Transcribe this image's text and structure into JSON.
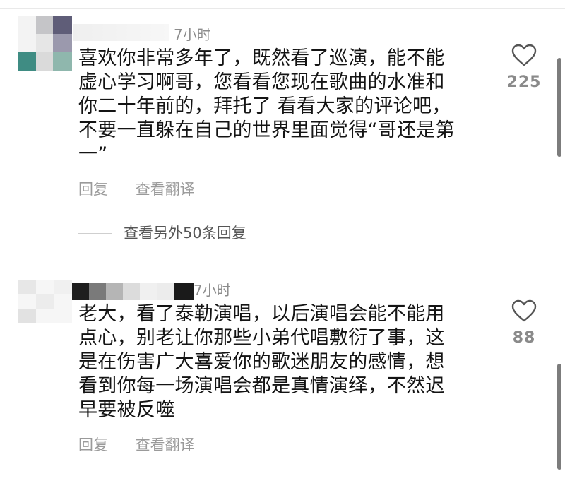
{
  "comments": [
    {
      "time": "7小时",
      "lines": [
        "喜欢你非常多年了，既然看了巡演，能不能",
        "虚心学习啊哥，您看看您现在歌曲的水准和",
        "你二十年前的，拜托了 看看大家的评论吧，",
        "不要一直躲在自己的世界里面觉得“哥还是第",
        "一”"
      ],
      "reply": "回复",
      "translate": "查看翻译",
      "likes": "225",
      "more_replies": "查看另外50条回复"
    },
    {
      "time": "7小时",
      "lines": [
        "老大，看了泰勒演唱，以后演唱会能不能用",
        "点心，别老让你那些小弟代唱敷衍了事，这",
        "是在伤害广大喜爱你的歌迷朋友的感情，想",
        "看到你每一场演唱会都是真情演绎，不然迟",
        "早要被反噬"
      ],
      "reply": "回复",
      "translate": "查看翻译",
      "likes": "88"
    }
  ],
  "icons": {
    "like": "heart-outline-icon"
  },
  "colors": {
    "text": "#141414",
    "meta": "#8c8c8c",
    "action": "#9a9a9a"
  }
}
